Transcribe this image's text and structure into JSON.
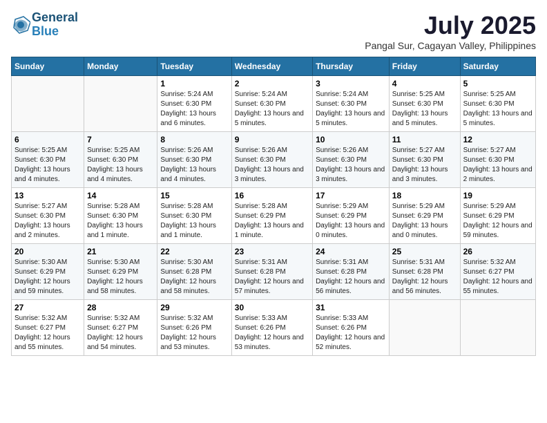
{
  "logo": {
    "line1": "General",
    "line2": "Blue"
  },
  "title": "July 2025",
  "location": "Pangal Sur, Cagayan Valley, Philippines",
  "weekdays": [
    "Sunday",
    "Monday",
    "Tuesday",
    "Wednesday",
    "Thursday",
    "Friday",
    "Saturday"
  ],
  "weeks": [
    [
      {
        "day": "",
        "info": ""
      },
      {
        "day": "",
        "info": ""
      },
      {
        "day": "1",
        "info": "Sunrise: 5:24 AM\nSunset: 6:30 PM\nDaylight: 13 hours and 6 minutes."
      },
      {
        "day": "2",
        "info": "Sunrise: 5:24 AM\nSunset: 6:30 PM\nDaylight: 13 hours and 5 minutes."
      },
      {
        "day": "3",
        "info": "Sunrise: 5:24 AM\nSunset: 6:30 PM\nDaylight: 13 hours and 5 minutes."
      },
      {
        "day": "4",
        "info": "Sunrise: 5:25 AM\nSunset: 6:30 PM\nDaylight: 13 hours and 5 minutes."
      },
      {
        "day": "5",
        "info": "Sunrise: 5:25 AM\nSunset: 6:30 PM\nDaylight: 13 hours and 5 minutes."
      }
    ],
    [
      {
        "day": "6",
        "info": "Sunrise: 5:25 AM\nSunset: 6:30 PM\nDaylight: 13 hours and 4 minutes."
      },
      {
        "day": "7",
        "info": "Sunrise: 5:25 AM\nSunset: 6:30 PM\nDaylight: 13 hours and 4 minutes."
      },
      {
        "day": "8",
        "info": "Sunrise: 5:26 AM\nSunset: 6:30 PM\nDaylight: 13 hours and 4 minutes."
      },
      {
        "day": "9",
        "info": "Sunrise: 5:26 AM\nSunset: 6:30 PM\nDaylight: 13 hours and 3 minutes."
      },
      {
        "day": "10",
        "info": "Sunrise: 5:26 AM\nSunset: 6:30 PM\nDaylight: 13 hours and 3 minutes."
      },
      {
        "day": "11",
        "info": "Sunrise: 5:27 AM\nSunset: 6:30 PM\nDaylight: 13 hours and 3 minutes."
      },
      {
        "day": "12",
        "info": "Sunrise: 5:27 AM\nSunset: 6:30 PM\nDaylight: 13 hours and 2 minutes."
      }
    ],
    [
      {
        "day": "13",
        "info": "Sunrise: 5:27 AM\nSunset: 6:30 PM\nDaylight: 13 hours and 2 minutes."
      },
      {
        "day": "14",
        "info": "Sunrise: 5:28 AM\nSunset: 6:30 PM\nDaylight: 13 hours and 1 minute."
      },
      {
        "day": "15",
        "info": "Sunrise: 5:28 AM\nSunset: 6:30 PM\nDaylight: 13 hours and 1 minute."
      },
      {
        "day": "16",
        "info": "Sunrise: 5:28 AM\nSunset: 6:29 PM\nDaylight: 13 hours and 1 minute."
      },
      {
        "day": "17",
        "info": "Sunrise: 5:29 AM\nSunset: 6:29 PM\nDaylight: 13 hours and 0 minutes."
      },
      {
        "day": "18",
        "info": "Sunrise: 5:29 AM\nSunset: 6:29 PM\nDaylight: 13 hours and 0 minutes."
      },
      {
        "day": "19",
        "info": "Sunrise: 5:29 AM\nSunset: 6:29 PM\nDaylight: 12 hours and 59 minutes."
      }
    ],
    [
      {
        "day": "20",
        "info": "Sunrise: 5:30 AM\nSunset: 6:29 PM\nDaylight: 12 hours and 59 minutes."
      },
      {
        "day": "21",
        "info": "Sunrise: 5:30 AM\nSunset: 6:29 PM\nDaylight: 12 hours and 58 minutes."
      },
      {
        "day": "22",
        "info": "Sunrise: 5:30 AM\nSunset: 6:28 PM\nDaylight: 12 hours and 58 minutes."
      },
      {
        "day": "23",
        "info": "Sunrise: 5:31 AM\nSunset: 6:28 PM\nDaylight: 12 hours and 57 minutes."
      },
      {
        "day": "24",
        "info": "Sunrise: 5:31 AM\nSunset: 6:28 PM\nDaylight: 12 hours and 56 minutes."
      },
      {
        "day": "25",
        "info": "Sunrise: 5:31 AM\nSunset: 6:28 PM\nDaylight: 12 hours and 56 minutes."
      },
      {
        "day": "26",
        "info": "Sunrise: 5:32 AM\nSunset: 6:27 PM\nDaylight: 12 hours and 55 minutes."
      }
    ],
    [
      {
        "day": "27",
        "info": "Sunrise: 5:32 AM\nSunset: 6:27 PM\nDaylight: 12 hours and 55 minutes."
      },
      {
        "day": "28",
        "info": "Sunrise: 5:32 AM\nSunset: 6:27 PM\nDaylight: 12 hours and 54 minutes."
      },
      {
        "day": "29",
        "info": "Sunrise: 5:32 AM\nSunset: 6:26 PM\nDaylight: 12 hours and 53 minutes."
      },
      {
        "day": "30",
        "info": "Sunrise: 5:33 AM\nSunset: 6:26 PM\nDaylight: 12 hours and 53 minutes."
      },
      {
        "day": "31",
        "info": "Sunrise: 5:33 AM\nSunset: 6:26 PM\nDaylight: 12 hours and 52 minutes."
      },
      {
        "day": "",
        "info": ""
      },
      {
        "day": "",
        "info": ""
      }
    ]
  ]
}
